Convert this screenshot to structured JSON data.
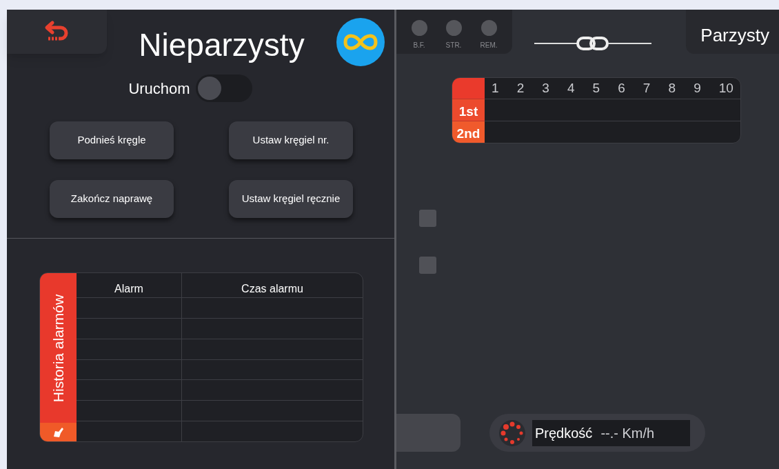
{
  "left_panel": {
    "title": "Nieparzysty",
    "toggle": {
      "label": "Uruchom",
      "on": false
    },
    "buttons": [
      "Podnieś kręgle",
      "Ustaw kręgiel nr.",
      "Zakończ naprawę",
      "Ustaw kręgiel ręcznie"
    ],
    "alarm_history": {
      "label": "Historia alarmów",
      "columns": [
        "Alarm",
        "Czas alarmu"
      ]
    }
  },
  "right_panel": {
    "indicators": [
      {
        "label": "B.F.",
        "on": false
      },
      {
        "label": "STR.",
        "on": false
      },
      {
        "label": "REM.",
        "on": false
      }
    ],
    "title": "Parzysty",
    "frame_table": {
      "columns": [
        "1",
        "2",
        "3",
        "4",
        "5",
        "6",
        "7",
        "8",
        "9",
        "10"
      ],
      "rows": [
        "1st",
        "2nd"
      ]
    },
    "checkboxes": [
      {
        "checked": false
      },
      {
        "checked": false
      }
    ],
    "speed": {
      "label": "Prędkość",
      "value": "--.- Km/h"
    }
  }
}
